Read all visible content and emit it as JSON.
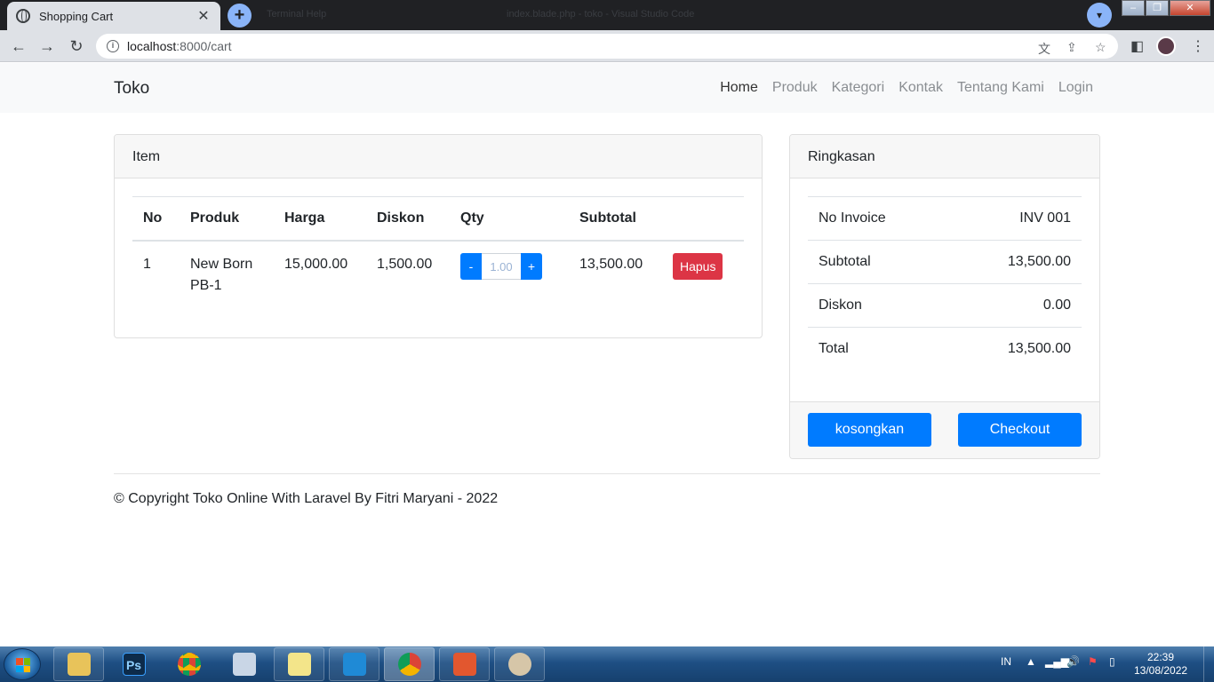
{
  "browser": {
    "tab_title": "Shopping Cart",
    "tab_close": "✕",
    "new_tab": "+",
    "bg_tab_1": "Terminal    Help",
    "bg_tab_2": "index.blade.php - toko - Visual Studio Code",
    "url_host": "localhost",
    "url_path": ":8000/cart",
    "info": "i"
  },
  "navbar": {
    "brand": "Toko",
    "links": [
      "Home",
      "Produk",
      "Kategori",
      "Kontak",
      "Tentang Kami",
      "Login"
    ]
  },
  "items_card": {
    "header": "Item",
    "columns": [
      "No",
      "Produk",
      "Harga",
      "Diskon",
      "Qty",
      "Subtotal"
    ],
    "rows": [
      {
        "no": "1",
        "produk": "New Born PB-1",
        "harga": "15,000.00",
        "diskon": "1,500.00",
        "qty": "1.00",
        "subtotal": "13,500.00",
        "minus": "-",
        "plus": "+",
        "delete_label": "Hapus"
      }
    ]
  },
  "summary_card": {
    "header": "Ringkasan",
    "rows": [
      {
        "label": "No Invoice",
        "value": "INV 001"
      },
      {
        "label": "Subtotal",
        "value": "13,500.00"
      },
      {
        "label": "Diskon",
        "value": "0.00"
      },
      {
        "label": "Total",
        "value": "13,500.00"
      }
    ],
    "clear_label": "kosongkan",
    "checkout_label": "Checkout"
  },
  "footer": {
    "copyright": "© Copyright Toko Online With Laravel By Fitri Maryani - 2022"
  },
  "taskbar": {
    "apps": [
      "Windows Explorer",
      "Photoshop",
      "Google Chrome",
      "On-Screen Keyboard",
      "Sticky Notes",
      "Visual Studio Code",
      "Google Chrome",
      "Screen Recorder",
      "Paint"
    ],
    "ps_label": "Ps",
    "language": "IN",
    "time": "22:39",
    "date": "13/08/2022"
  },
  "colors": {
    "primary": "#007bff",
    "danger": "#dc3545",
    "navbar_bg": "#f8f9fa"
  }
}
